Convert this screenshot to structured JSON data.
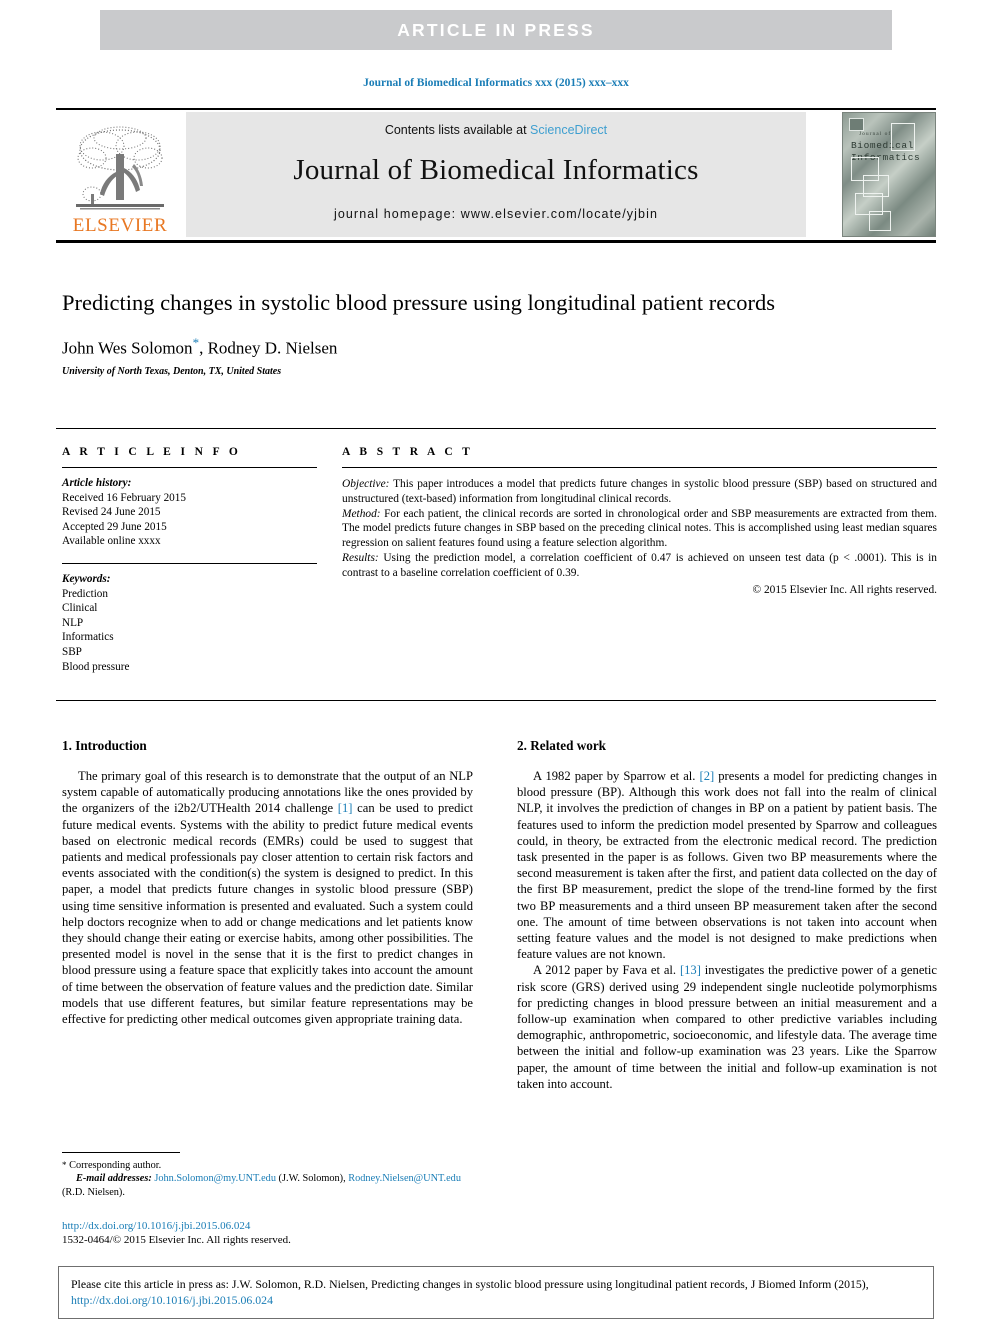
{
  "banner": {
    "text": "ARTICLE  IN  PRESS"
  },
  "running_head": "Journal of Biomedical Informatics xxx (2015) xxx–xxx",
  "masthead": {
    "contents_prefix": "Contents lists available at ",
    "sciencedirect": "ScienceDirect",
    "journal_name": "Journal of Biomedical Informatics",
    "homepage": "journal homepage: www.elsevier.com/locate/yjbin",
    "publisher_wordmark": "ELSEVIER",
    "cover_kicker": "Journal of",
    "cover_title_line1": "Biomedical",
    "cover_title_line2": "Informatics"
  },
  "title": "Predicting changes in systolic blood pressure using longitudinal patient records",
  "authors": {
    "author1": "John Wes Solomon",
    "corresponding_mark": "*",
    "author2": ", Rodney D. Nielsen",
    "affiliation": "University of North Texas, Denton, TX, United States"
  },
  "article_info": {
    "heading": "A R T I C L E    I N F O",
    "history_label": "Article history:",
    "history": [
      "Received 16 February 2015",
      "Revised 24 June 2015",
      "Accepted 29 June 2015",
      "Available online xxxx"
    ],
    "keywords_label": "Keywords:",
    "keywords": [
      "Prediction",
      "Clinical",
      "NLP",
      "Informatics",
      "SBP",
      "Blood pressure"
    ]
  },
  "abstract": {
    "heading": "A B S T R A C T",
    "objective_label": "Objective:",
    "objective_text": " This paper introduces a model that predicts future changes in systolic blood pressure (SBP) based on structured and unstructured (text-based) information from longitudinal clinical records.",
    "method_label": "Method:",
    "method_text": " For each patient, the clinical records are sorted in chronological order and SBP measurements are extracted from them. The model predicts future changes in SBP based on the preceding clinical notes. This is accomplished using least median squares regression on salient features found using a feature selection algorithm.",
    "results_label": "Results:",
    "results_text": " Using the prediction model, a correlation coefficient of 0.47 is achieved on unseen test data (p < .0001). This is in contrast to a baseline correlation coefficient of 0.39.",
    "copyright": "© 2015 Elsevier Inc. All rights reserved."
  },
  "sections": {
    "intro": {
      "heading": "1. Introduction",
      "paragraph_pre": "The primary goal of this research is to demonstrate that the output of an NLP system capable of automatically producing annotations like the ones provided by the organizers of the i2b2/UTHealth 2014 challenge ",
      "ref": "[1]",
      "paragraph_post": " can be used to predict future medical events. Systems with the ability to predict future medical events based on electronic medical records (EMRs) could be used to suggest that patients and medical professionals pay closer attention to certain risk factors and events associated with the condition(s) the system is designed to predict. In this paper, a model that predicts future changes in systolic blood pressure (SBP) using time sensitive information is presented and evaluated. Such a system could help doctors recognize when to add or change medications and let patients know they should change their eating or exercise habits, among other possibilities. The presented model is novel in the sense that it is the first to predict changes in blood pressure using a feature space that explicitly takes into account the amount of time between the observation of feature values and the prediction date. Similar models that use different features, but similar feature representations may be effective for predicting other medical outcomes given appropriate training data."
    },
    "related": {
      "heading": "2. Related work",
      "p1_pre": "A 1982 paper by Sparrow et al. ",
      "p1_ref": "[2]",
      "p1_post": " presents a model for predicting changes in blood pressure (BP). Although this work does not fall into the realm of clinical NLP, it involves the prediction of changes in BP on a patient by patient basis. The features used to inform the prediction model presented by Sparrow and colleagues could, in theory, be extracted from the electronic medical record. The prediction task presented in the paper is as follows. Given two BP measurements where the second measurement is taken after the first, and patient data collected on the day of the first BP measurement, predict the slope of the trend-line formed by the first two BP measurements and a third unseen BP measurement taken after the second one. The amount of time between observations is not taken into account when setting feature values and the model is not designed to make predictions when feature values are not known.",
      "p2_pre": "A 2012 paper by Fava et al. ",
      "p2_ref": "[13]",
      "p2_post": " investigates the predictive power of a genetic risk score (GRS) derived using 29 independent single nucleotide polymorphisms for predicting changes in blood pressure between an initial measurement and a follow-up examination when compared to other predictive variables including demographic, anthropometric, socioeconomic, and lifestyle data. The average time between the initial and follow-up examination was 23 years. Like the Sparrow paper, the amount of time between the initial and follow-up examination is not taken into account."
    }
  },
  "footnote": {
    "star": "*",
    "corresponding": " Corresponding author.",
    "email_label": "E-mail addresses:",
    "email1": "John.Solomon@my.UNT.edu",
    "email1_owner": " (J.W. Solomon), ",
    "email2": "Rodney.Nielsen@UNT.edu",
    "email2_owner": " (R.D. Nielsen)."
  },
  "doi_block": {
    "doi_url": "http://dx.doi.org/10.1016/j.jbi.2015.06.024",
    "issn_line": "1532-0464/© 2015 Elsevier Inc. All rights reserved."
  },
  "cite_footer": {
    "text_pre": "Please cite this article in press as: J.W. Solomon, R.D. Nielsen, Predicting changes in systolic blood pressure using longitudinal patient records, J Biomed Inform (2015), ",
    "link": "http://dx.doi.org/10.1016/j.jbi.2015.06.024"
  },
  "colors": {
    "banner_gray": "#c9cacc",
    "masthead_gray": "#e6e6e6",
    "link_blue": "#1a7db6",
    "sciencedirect_blue": "#3f9fd0",
    "elsevier_orange": "#e87722"
  }
}
